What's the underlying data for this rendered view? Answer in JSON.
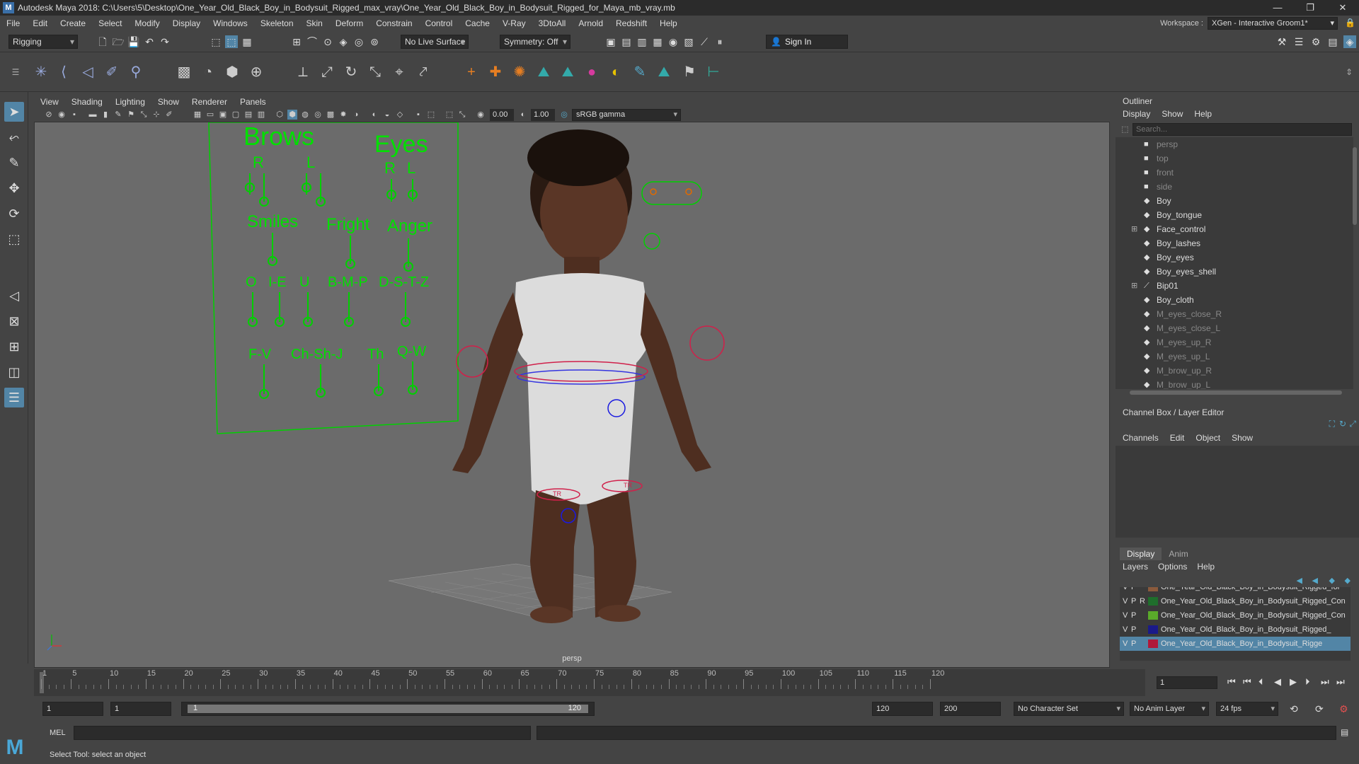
{
  "titlebar": {
    "title": "Autodesk Maya 2018: C:\\Users\\5\\Desktop\\One_Year_Old_Black_Boy_in_Bodysuit_Rigged_max_vray\\One_Year_Old_Black_Boy_in_Bodysuit_Rigged_for_Maya_mb_vray.mb",
    "minimize": "—",
    "restore": "❐",
    "close": "✕"
  },
  "menubar": {
    "items": [
      "File",
      "Edit",
      "Create",
      "Select",
      "Modify",
      "Display",
      "Windows",
      "Skeleton",
      "Skin",
      "Deform",
      "Constrain",
      "Control",
      "Cache",
      "V-Ray",
      "3DtoAll",
      "Arnold",
      "Redshift",
      "Help"
    ],
    "workspace_label": "Workspace :",
    "workspace_value": "XGen - Interactive Groom1*"
  },
  "statusline": {
    "menuset": "Rigging",
    "live_surface": "No Live Surface",
    "symmetry": "Symmetry: Off",
    "signin": "Sign In"
  },
  "viewport_menu": {
    "items": [
      "View",
      "Shading",
      "Lighting",
      "Show",
      "Renderer",
      "Panels"
    ],
    "exposure": "0.00",
    "gamma": "1.00",
    "colorspace": "sRGB gamma"
  },
  "viewport": {
    "camera": "persp",
    "face_board": {
      "brows": "Brows",
      "eyes": "Eyes",
      "r": "R",
      "l": "L",
      "smiles": "Smiles",
      "fright": "Fright",
      "anger": "Anger",
      "o": "O",
      "ie": "I-E",
      "u": "U",
      "bmp": "B-M-P",
      "dstz": "D-S-T-Z",
      "fv": "F-V",
      "chshj": "Ch-Sh-J",
      "th": "Th",
      "qw": "Q-W"
    },
    "foot_tag_l": "TR",
    "foot_tag_r": "TR"
  },
  "outliner": {
    "title": "Outliner",
    "menu": [
      "Display",
      "Show",
      "Help"
    ],
    "search_placeholder": "Search...",
    "items": [
      {
        "label": "persp",
        "type": "cam"
      },
      {
        "label": "top",
        "type": "cam"
      },
      {
        "label": "front",
        "type": "cam"
      },
      {
        "label": "side",
        "type": "cam"
      },
      {
        "label": "Boy",
        "type": "mesh"
      },
      {
        "label": "Boy_tongue",
        "type": "mesh"
      },
      {
        "label": "Face_control",
        "type": "mesh",
        "expand": true
      },
      {
        "label": "Boy_lashes",
        "type": "mesh"
      },
      {
        "label": "Boy_eyes",
        "type": "mesh"
      },
      {
        "label": "Boy_eyes_shell",
        "type": "mesh"
      },
      {
        "label": "Bip01",
        "type": "joint",
        "expand": true
      },
      {
        "label": "Boy_cloth",
        "type": "mesh"
      },
      {
        "label": "M_eyes_close_R",
        "type": "dim"
      },
      {
        "label": "M_eyes_close_L",
        "type": "dim"
      },
      {
        "label": "M_eyes_up_R",
        "type": "dim"
      },
      {
        "label": "M_eyes_up_L",
        "type": "dim"
      },
      {
        "label": "M_brow_up_R",
        "type": "dim"
      },
      {
        "label": "M_brow_up_L",
        "type": "dim"
      }
    ]
  },
  "channelbox": {
    "title": "Channel Box / Layer Editor",
    "menu": [
      "Channels",
      "Edit",
      "Object",
      "Show"
    ]
  },
  "layer_editor": {
    "tabs": [
      "Display",
      "Anim"
    ],
    "menu": [
      "Layers",
      "Options",
      "Help"
    ],
    "layers": [
      {
        "v": "V",
        "p": "P",
        "r": "",
        "color": "#8a5a3c",
        "name": "One_Year_Old_Black_Boy_in_Bodysuit_Rigged_for"
      },
      {
        "v": "V",
        "p": "P",
        "r": "R",
        "color": "#1f6e2c",
        "name": "One_Year_Old_Black_Boy_in_Bodysuit_Rigged_Con"
      },
      {
        "v": "V",
        "p": "P",
        "r": "",
        "color": "#5aaa2a",
        "name": "One_Year_Old_Black_Boy_in_Bodysuit_Rigged_Con"
      },
      {
        "v": "V",
        "p": "P",
        "r": "",
        "color": "#1a1a8a",
        "name": "One_Year_Old_Black_Boy_in_Bodysuit_Rigged_"
      },
      {
        "v": "V",
        "p": "P",
        "r": "",
        "color": "#b0183a",
        "name": "One_Year_Old_Black_Boy_in_Bodysuit_Rigge"
      }
    ]
  },
  "timeline": {
    "labels": [
      "1",
      "5",
      "10",
      "15",
      "20",
      "25",
      "30",
      "35",
      "40",
      "45",
      "50",
      "55",
      "60",
      "65",
      "70",
      "75",
      "80",
      "85",
      "90",
      "95",
      "100",
      "105",
      "110",
      "115",
      "120"
    ],
    "current_frame": "1"
  },
  "range": {
    "start": "1",
    "playback_start": "1",
    "slider_start": "1",
    "slider_end": "120",
    "playback_end": "120",
    "end": "200",
    "character_set": "No Character Set",
    "anim_layer": "No Anim Layer",
    "fps": "24 fps"
  },
  "cmdline": {
    "mode": "MEL"
  },
  "helpline": {
    "text": "Select Tool: select an object"
  }
}
